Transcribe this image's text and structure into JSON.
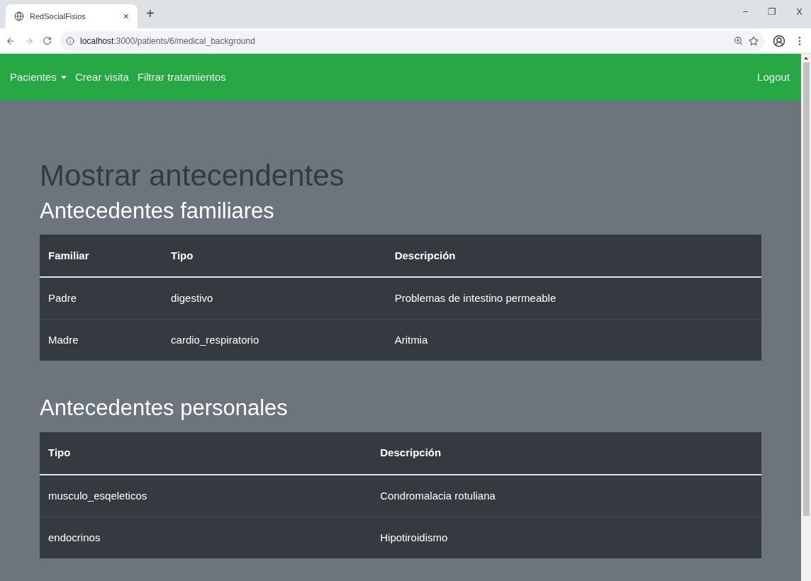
{
  "browser": {
    "tab_title": "RedSocialFisios",
    "tab_close": "×",
    "new_tab": "+",
    "window_controls": [
      "−",
      "❐",
      "X"
    ],
    "url_host": "localhost",
    "url_rest": ":3000/patients/6/medical_background"
  },
  "navbar": {
    "items": [
      {
        "label": "Pacientes",
        "kind": "dropdown"
      },
      {
        "label": "Crear visita",
        "kind": "link"
      },
      {
        "label": "Filtrar tratamientos",
        "kind": "link"
      }
    ],
    "logout": "Logout"
  },
  "page_title": "Mostrar antecendentes",
  "sections": [
    {
      "title": "Antecedentes familiares",
      "columns": [
        "Familiar",
        "Tipo",
        "Descripción"
      ],
      "rows": [
        [
          "Padre",
          "digestivo",
          "Problemas de intestino permeable"
        ],
        [
          "Madre",
          "cardio_respiratorio",
          "Aritmia"
        ]
      ]
    },
    {
      "title": "Antecedentes personales",
      "columns": [
        "Tipo",
        "Descripción"
      ],
      "rows": [
        [
          "musculo_esqeleticos",
          "Condromalacia rotuliana"
        ],
        [
          "endocrinos",
          "Hipotiroidismo"
        ]
      ]
    }
  ]
}
